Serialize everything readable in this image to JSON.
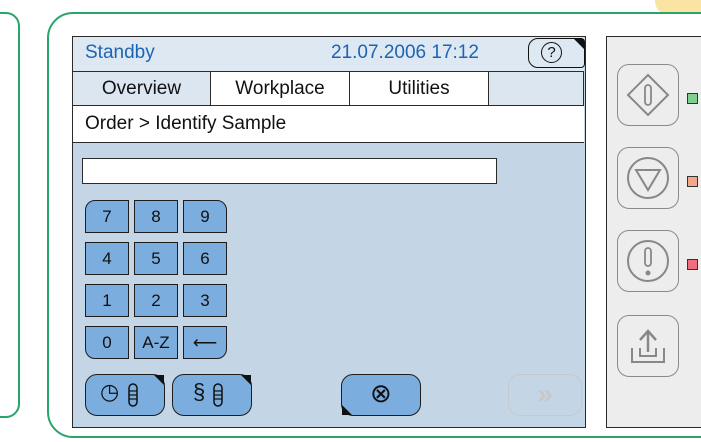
{
  "status_bar": {
    "title": "Standby",
    "datetime": "21.07.2006 17:12",
    "help_symbol": "?"
  },
  "tabs": [
    {
      "label": "Overview",
      "active": true
    },
    {
      "label": "Workplace",
      "active": false
    },
    {
      "label": "Utilities",
      "active": false
    },
    {
      "label": "",
      "active": false
    }
  ],
  "breadcrumb": "Order > Identify Sample",
  "sample_input": {
    "value": "",
    "placeholder": ""
  },
  "keypad": {
    "keys": [
      "7",
      "8",
      "9",
      "4",
      "5",
      "6",
      "1",
      "2",
      "3",
      "0",
      "A-Z",
      "⟵"
    ]
  },
  "bottom_buttons": {
    "clock_sample_symbol": "◷",
    "section_sample_symbol": "§",
    "cancel_symbol": "⊗",
    "next_symbol": "»",
    "next_enabled": false
  },
  "side_panel": {
    "buttons": [
      "start-diamond-icon",
      "stop-triangle-icon",
      "alert-exclamation-icon",
      "upload-tray-icon"
    ],
    "leds": [
      {
        "name": "start-led",
        "color": "#7fcf8f"
      },
      {
        "name": "stop-led",
        "color": "#f4a78a"
      },
      {
        "name": "alert-led",
        "color": "#ef6f7c"
      }
    ]
  },
  "colors": {
    "accent": "#1c64b4",
    "bezel": "#2aa56a",
    "screen_bg": "#c4d5e5",
    "key_fill": "#7badde"
  }
}
